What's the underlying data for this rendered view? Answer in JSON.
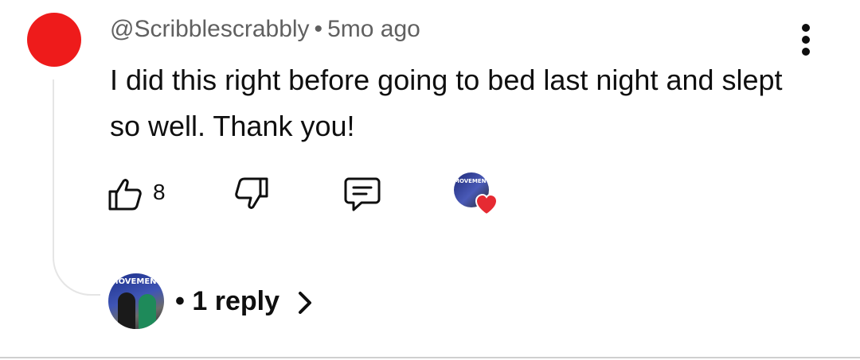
{
  "comment": {
    "author": "@Scribblescrabbly",
    "separator": "•",
    "time_ago": "5mo ago",
    "text": "I did this right before going to bed last night and slept so well. Thank you!",
    "avatar_color": "#ee1b1b"
  },
  "actions": {
    "like_count": "8",
    "like_icon": "thumbs-up-icon",
    "dislike_icon": "thumbs-down-icon",
    "reply_icon": "comment-icon",
    "creator_heart_icon": "heart-icon",
    "creator_logo_text": "MOVEMENT"
  },
  "replies": {
    "separator": "•",
    "label": "1 reply",
    "chevron_icon": "chevron-right-icon",
    "avatar_logo_text": "MOVEMENT"
  },
  "menu_icon": "more-vert-icon",
  "colors": {
    "accent_red": "#ee1b1b",
    "heart": "#e62a32",
    "meta_gray": "#606060"
  }
}
